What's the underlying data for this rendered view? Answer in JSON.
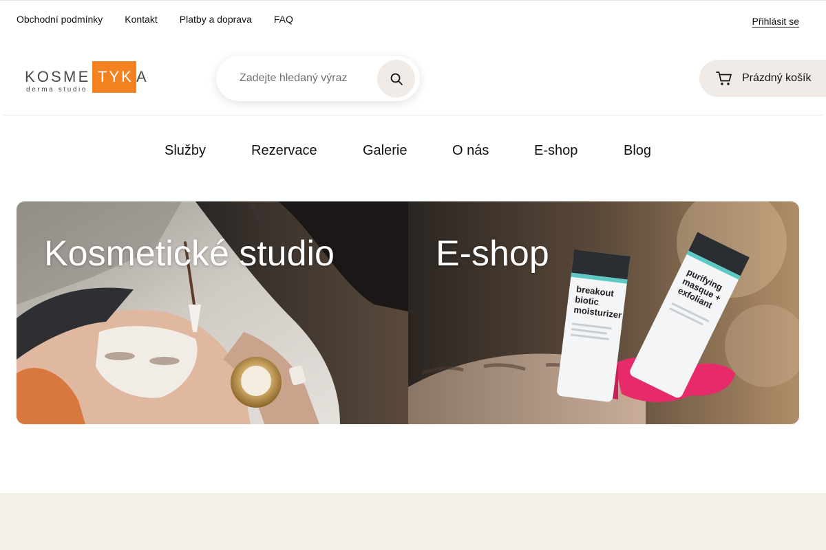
{
  "top_links": [
    "Obchodní podmínky",
    "Kontakt",
    "Platby a doprava",
    "FAQ"
  ],
  "login_label": "Přihlásit se",
  "logo": {
    "text_left": "KOSME",
    "text_box": "TYK",
    "text_right": "A",
    "subtitle": "derma studio",
    "accent_color": "#f58220"
  },
  "search": {
    "placeholder": "Zadejte hledaný výraz",
    "value": "",
    "icon": "search-icon"
  },
  "cart": {
    "label": "Prázdný košík",
    "icon": "cart-icon"
  },
  "main_nav": [
    "Služby",
    "Rezervace",
    "Galerie",
    "O nás",
    "E-shop",
    "Blog"
  ],
  "banners": [
    {
      "title": "Kosmetické studio"
    },
    {
      "title": "E-shop"
    }
  ],
  "products": [
    {
      "lines": [
        "breakout",
        "biotic",
        "moisturizer"
      ]
    },
    {
      "lines": [
        "purifying",
        "masque +",
        "exfoliant"
      ]
    }
  ],
  "colors": {
    "accent": "#f58220",
    "beige": "#f3efe9",
    "button_bg": "#f0ebe6",
    "heading_green": "#6c7a63"
  }
}
